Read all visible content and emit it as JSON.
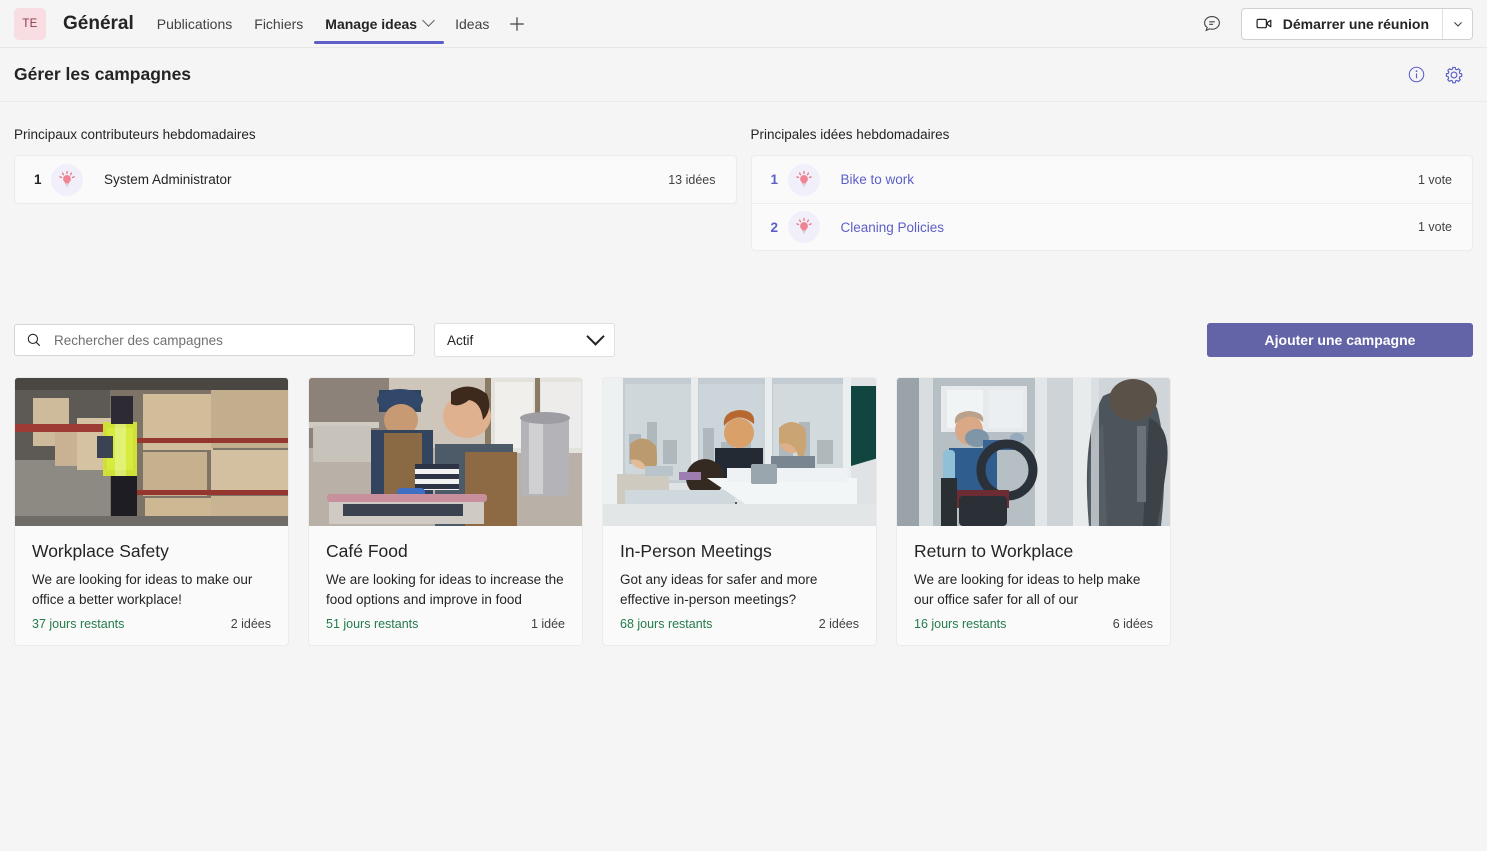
{
  "topbar": {
    "avatar_initials": "TE",
    "channel": "Général",
    "tabs": [
      {
        "label": "Publications",
        "active": false,
        "has_chevron": false
      },
      {
        "label": "Fichiers",
        "active": false,
        "has_chevron": false
      },
      {
        "label": "Manage ideas",
        "active": true,
        "has_chevron": true
      },
      {
        "label": "Ideas",
        "active": false,
        "has_chevron": false
      }
    ],
    "add_tab_icon": "plus-icon",
    "chat_icon": "chat-bubble-icon",
    "meeting_button": "Démarrer une réunion",
    "meeting_icon": "video-camera-icon",
    "meeting_split_icon": "chevron-down-icon"
  },
  "page_header": {
    "title": "Gérer les campagnes",
    "info_icon": "info-circle-icon",
    "settings_icon": "gear-icon",
    "accent_color": "#5b5fc7"
  },
  "contributors": {
    "label": "Principaux contributeurs hebdomadaires",
    "rows": [
      {
        "rank": "1",
        "icon": "lightbulb-icon",
        "name": "System Administrator",
        "meta": "13 idées"
      }
    ]
  },
  "top_ideas": {
    "label": "Principales idées hebdomadaires",
    "rows": [
      {
        "rank": "1",
        "icon": "lightbulb-icon",
        "name": "Bike to work",
        "meta": "1 vote"
      },
      {
        "rank": "2",
        "icon": "lightbulb-icon",
        "name": "Cleaning Policies",
        "meta": "1 vote"
      }
    ]
  },
  "toolbar": {
    "search_placeholder": "Rechercher des campagnes",
    "search_value": "",
    "search_icon": "search-icon",
    "filter_value": "Actif",
    "filter_options": [
      "Actif"
    ],
    "filter_icon": "chevron-down-icon",
    "add_campaign_label": "Ajouter une campagne",
    "accent_color": "#6264a7"
  },
  "campaigns": [
    {
      "image": "warehouse-worker-photo",
      "title": "Workplace Safety",
      "description": "We are looking for ideas to make our office a better workplace!",
      "days": "37 jours restants",
      "ideas": "2 idées"
    },
    {
      "image": "cafe-kitchen-workers-photo",
      "title": "Café Food",
      "description": "We are looking for ideas to increase the food options and improve in food",
      "days": "51 jours restants",
      "ideas": "1 idée"
    },
    {
      "image": "office-meeting-photo",
      "title": "In-Person Meetings",
      "description": "Got any ideas for safer and more effective in-person meetings?",
      "days": "68 jours restants",
      "ideas": "2 idées"
    },
    {
      "image": "bus-driver-mask-photo",
      "title": "Return to Workplace",
      "description": "We are looking for ideas to help make our office safer for all of our",
      "days": "16 jours restants",
      "ideas": "6 idées"
    }
  ],
  "colors": {
    "days_green": "#237b4b",
    "link_purple": "#5b5fc7",
    "brand_purple": "#6264a7"
  }
}
